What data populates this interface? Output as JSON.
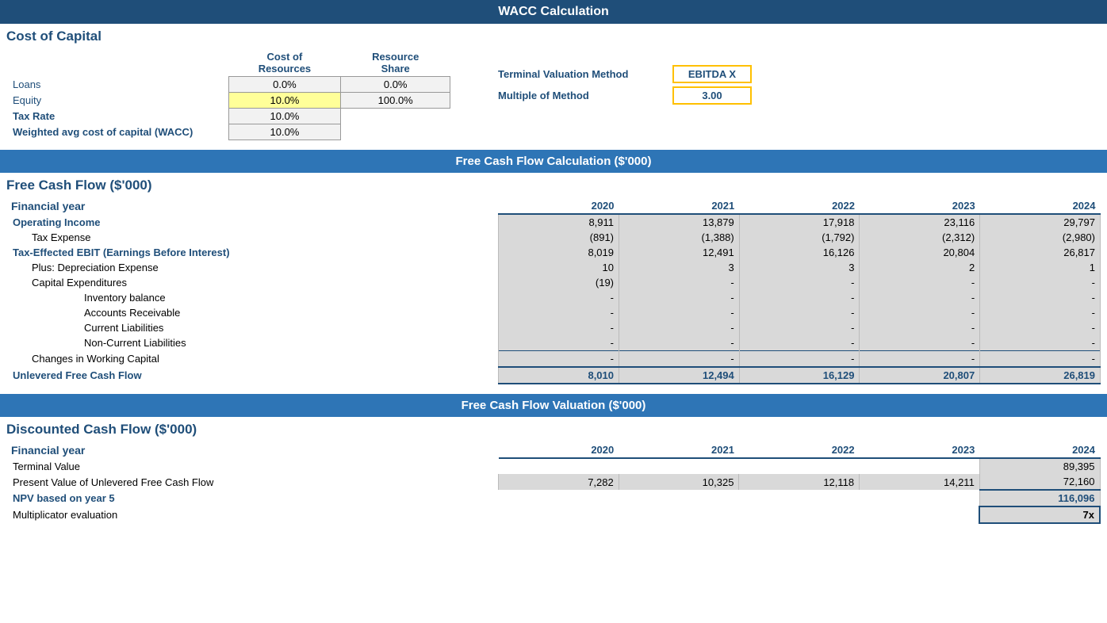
{
  "main_header": "WACC Calculation",
  "cost_of_capital": {
    "title": "Cost of Capital",
    "col_headers": [
      "Cost of Resources",
      "Resource Share"
    ],
    "rows": [
      {
        "label": "Loans",
        "cost": "0.0%",
        "share": "0.0%",
        "label_bold": false
      },
      {
        "label": "Equity",
        "cost": "10.0%",
        "share": "100.0%",
        "label_bold": false
      },
      {
        "label": "Tax Rate",
        "cost": "10.0%",
        "share": "",
        "label_bold": true
      },
      {
        "label": "Weighted avg cost of capital (WACC)",
        "cost": "10.0%",
        "share": "",
        "label_bold": true
      }
    ],
    "terminal": {
      "method_label": "Terminal Valuation Method",
      "method_value": "EBITDA X",
      "multiple_label": "Multiple of Method",
      "multiple_value": "3.00"
    }
  },
  "fcf_section": {
    "header": "Free Cash Flow Calculation ($'000)",
    "title": "Free Cash Flow ($'000)",
    "col_label": "Financial year",
    "years": [
      "2020",
      "2021",
      "2022",
      "2023",
      "2024"
    ],
    "rows": [
      {
        "label": "Operating Income",
        "indent": 0,
        "bold": true,
        "values": [
          "8,911",
          "13,879",
          "17,918",
          "23,116",
          "29,797"
        ]
      },
      {
        "label": "Tax Expense",
        "indent": 1,
        "bold": false,
        "values": [
          "(891)",
          "(1,388)",
          "(1,792)",
          "(2,312)",
          "(2,980)"
        ]
      },
      {
        "label": "Tax-Effected EBIT (Earnings Before Interest)",
        "indent": 0,
        "bold": true,
        "ebit": true,
        "values": [
          "8,019",
          "12,491",
          "16,126",
          "20,804",
          "26,817"
        ]
      },
      {
        "label": "Plus: Depreciation Expense",
        "indent": 1,
        "bold": false,
        "values": [
          "10",
          "3",
          "3",
          "2",
          "1"
        ]
      },
      {
        "label": "Capital Expenditures",
        "indent": 1,
        "bold": false,
        "values": [
          "(19)",
          "-",
          "-",
          "-",
          "-"
        ]
      },
      {
        "label": "Inventory balance",
        "indent": 2,
        "bold": false,
        "values": [
          "-",
          "-",
          "-",
          "-",
          "-"
        ]
      },
      {
        "label": "Accounts Receivable",
        "indent": 2,
        "bold": false,
        "values": [
          "-",
          "-",
          "-",
          "-",
          "-"
        ]
      },
      {
        "label": "Current Liabilities",
        "indent": 2,
        "bold": false,
        "values": [
          "-",
          "-",
          "-",
          "-",
          "-"
        ]
      },
      {
        "label": "Non-Current Liabilities",
        "indent": 2,
        "bold": false,
        "values": [
          "-",
          "-",
          "-",
          "-",
          "-"
        ]
      },
      {
        "label": "Changes in Working Capital",
        "indent": 1,
        "bold": false,
        "border_top": true,
        "values": [
          "-",
          "-",
          "-",
          "-",
          "-"
        ]
      },
      {
        "label": "Unlevered Free Cash Flow",
        "indent": 0,
        "bold": true,
        "unlevered": true,
        "values": [
          "8,010",
          "12,494",
          "16,129",
          "20,807",
          "26,819"
        ]
      }
    ]
  },
  "valuation_section": {
    "header": "Free Cash Flow Valuation ($'000)",
    "title": "Discounted Cash Flow ($'000)",
    "col_label": "Financial year",
    "years": [
      "2020",
      "2021",
      "2022",
      "2023",
      "2024"
    ],
    "rows": [
      {
        "label": "Terminal Value",
        "indent": 0,
        "bold": false,
        "values": [
          "",
          "",
          "",
          "",
          "89,395"
        ]
      },
      {
        "label": "Present Value of Unlevered Free Cash Flow",
        "indent": 0,
        "bold": false,
        "values": [
          "7,282",
          "10,325",
          "12,118",
          "14,211",
          "72,160"
        ]
      }
    ],
    "npv_label": "NPV based on year 5",
    "npv_value": "116,096",
    "multiplicator_label": "Multiplicator evaluation",
    "multiplicator_value": "7x"
  }
}
